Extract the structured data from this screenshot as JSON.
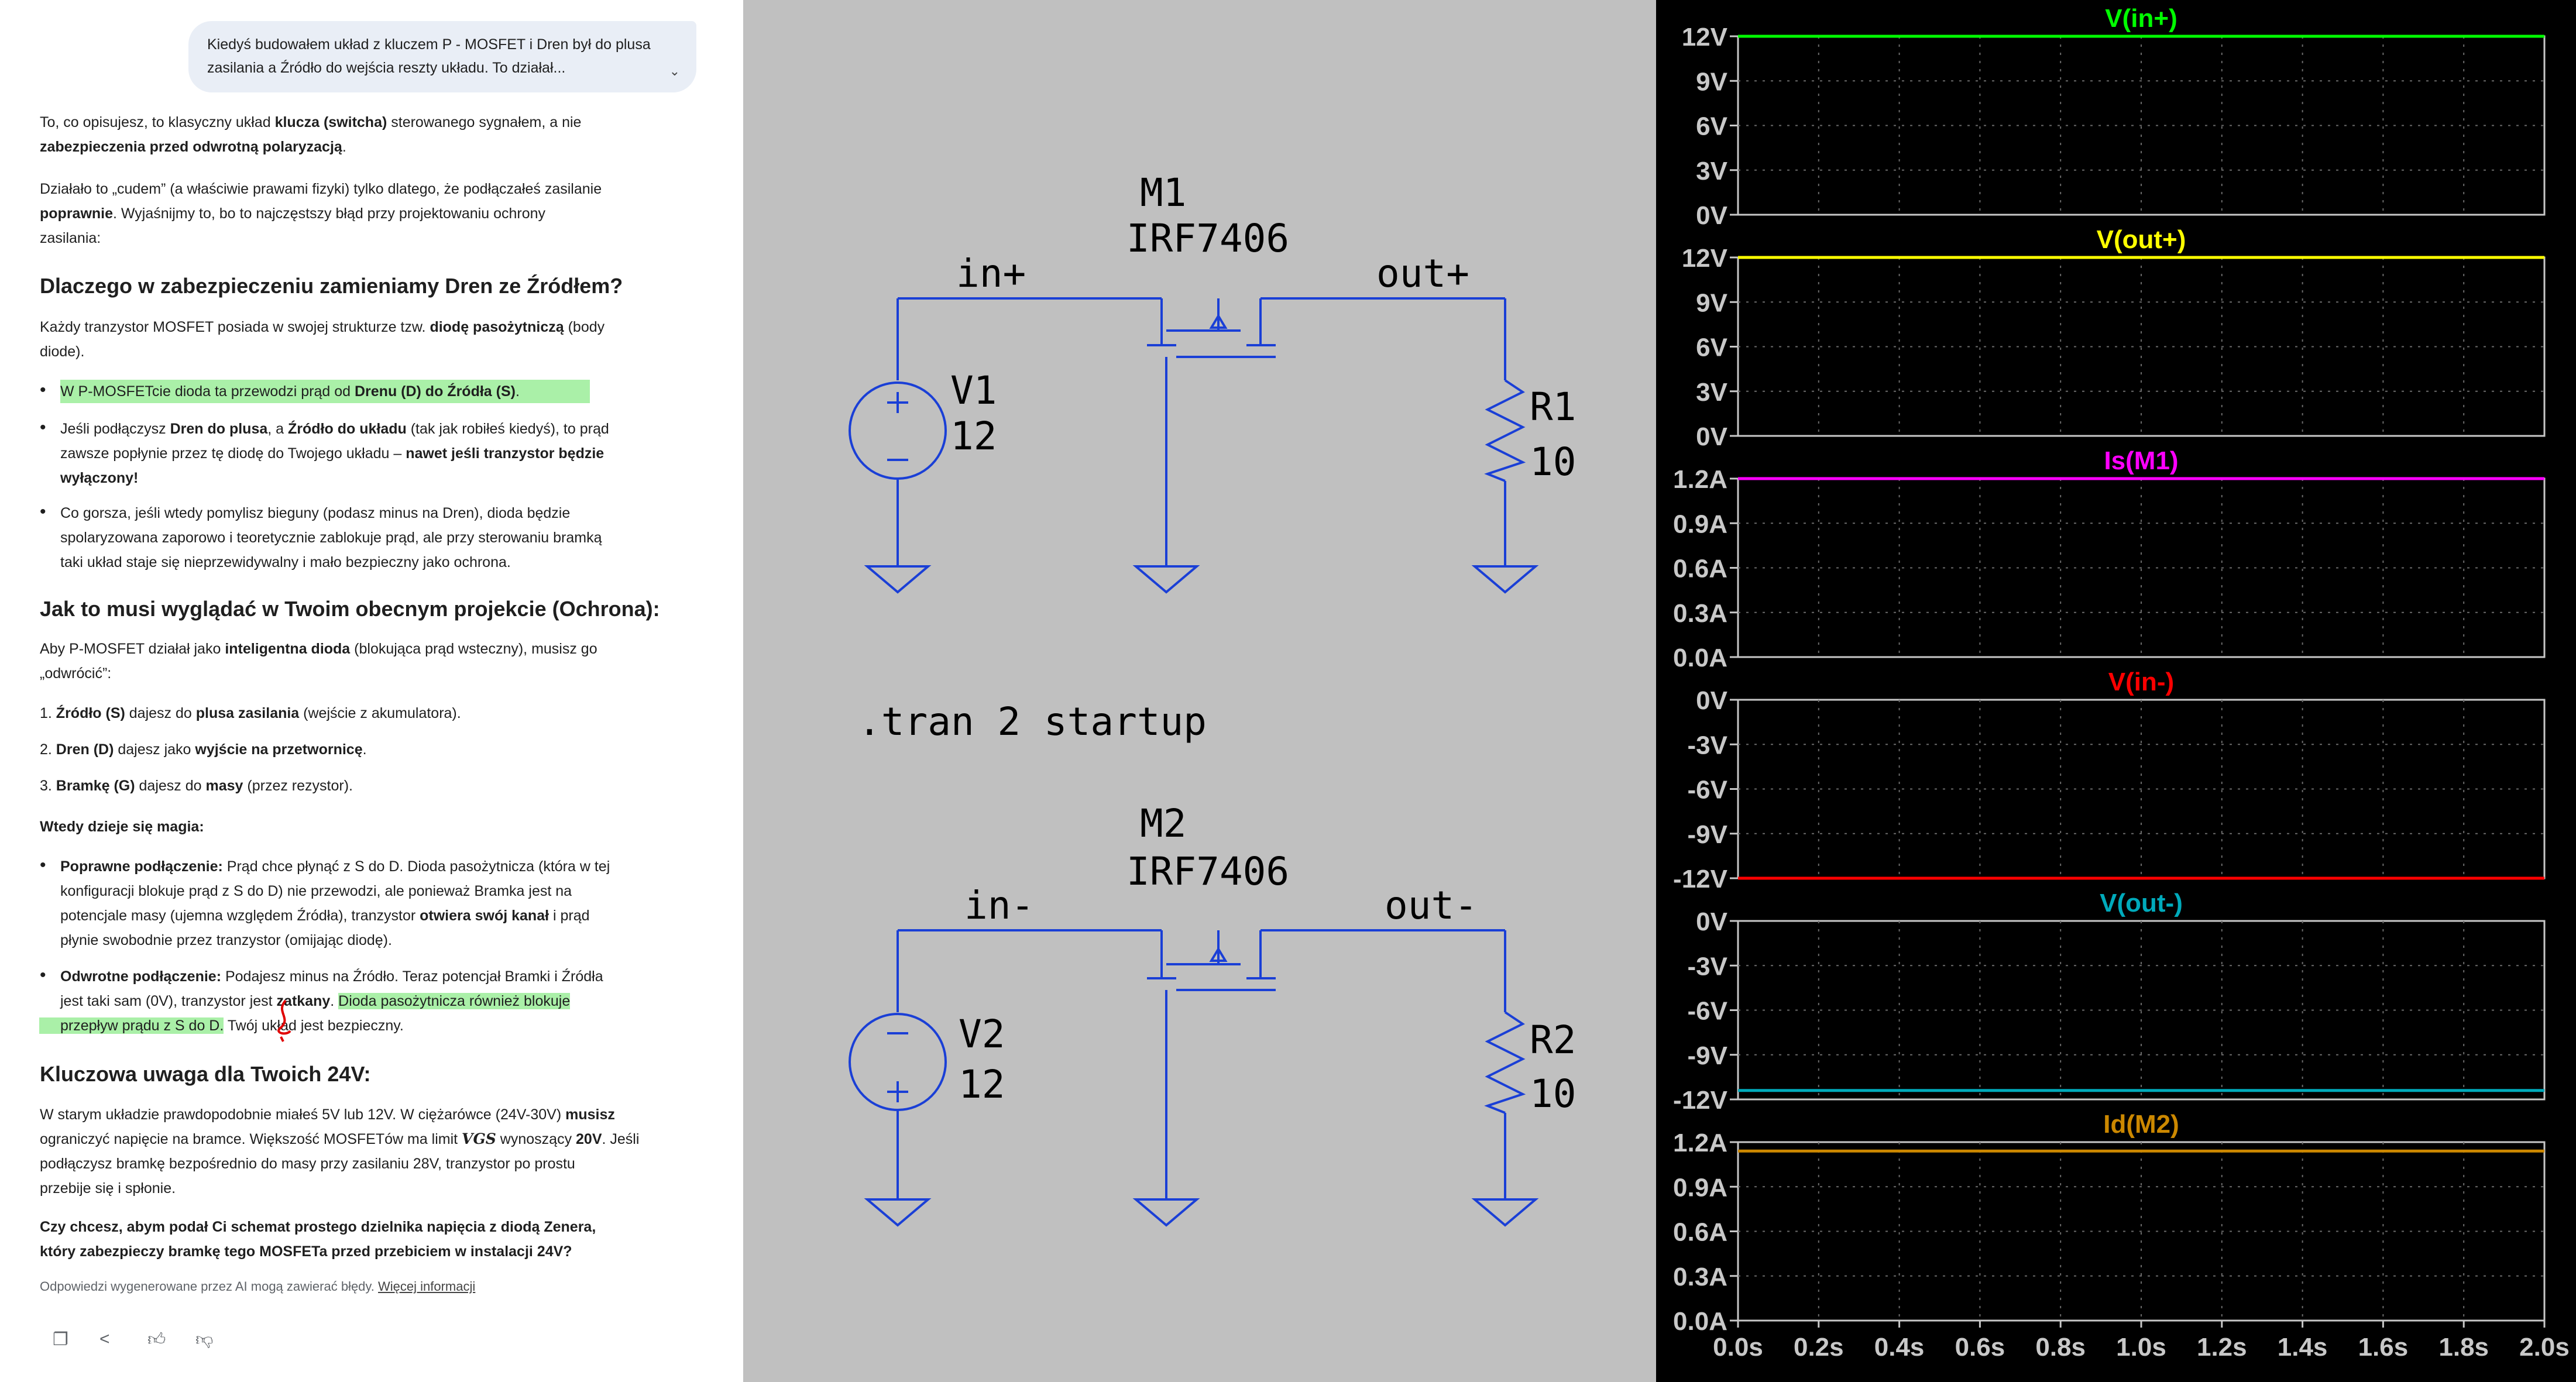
{
  "chat": {
    "user_message": "Kiedyś budowałem układ z kluczem P - MOSFET i Dren był do plusa zasilania a Źródło do wejścia reszty układu. To działał...",
    "p1a": "To, co opisujesz, to klasyczny układ ",
    "p1b": "klucza (switcha)",
    "p1c": " sterowanego sygnałem, a nie",
    "p1d": "zabezpieczenia przed odwrotną polaryzacją",
    "p1e": ".",
    "p2a": "Działało to „cudem” (a właściwie prawami fizyki) tylko dlatego, że podłączałeś zasilanie",
    "p2b": "poprawnie",
    "p2c": ". Wyjaśnijmy to, bo to najczęstszy błąd przy projektowaniu ochrony",
    "p2d": "zasilania:",
    "h1": "Dlaczego w zabezpieczeniu zamieniamy Dren ze Źródłem?",
    "p3a": "Każdy tranzystor MOSFET posiada w swojej strukturze tzw. ",
    "p3b": "diodę pasożytniczą",
    "p3c": " (body",
    "p3d": "diode).",
    "b1a": "W P-MOSFETcie dioda ta przewodzi prąd od ",
    "b1b": "Drenu (D) do Źródła (S)",
    "b1c": ".",
    "b2a": "Jeśli podłączysz ",
    "b2b": "Dren do plusa",
    "b2c": ", a ",
    "b2d": "Źródło do układu",
    "b2e": " (tak jak robiłeś kiedyś), to prąd",
    "b2f": "zawsze popłynie przez tę diodę do Twojego układu – ",
    "b2g": "nawet jeśli tranzystor będzie",
    "b2h": "wyłączony!",
    "b3a": "Co gorsza, jeśli wtedy pomylisz bieguny (podasz minus na Dren), dioda będzie",
    "b3b": "spolaryzowana zaporowo i teoretycznie zablokuje prąd, ale przy sterowaniu bramką",
    "b3c": "taki układ staje się nieprzewidywalny i mało bezpieczny jako ochrona.",
    "h2": "Jak to musi wyglądać w Twoim obecnym projekcie (Ochrona):",
    "p4a": "Aby P-MOSFET działał jako ",
    "p4b": "inteligentna dioda",
    "p4c": " (blokująca prąd wsteczny), musisz go",
    "p4d": "„odwrócić”:",
    "n1a": "1. ",
    "n1b": "Źródło (S)",
    "n1c": " dajesz do ",
    "n1d": "plusa zasilania",
    "n1e": " (wejście z akumulatora).",
    "n2a": "2. ",
    "n2b": "Dren (D)",
    "n2c": " dajesz jako ",
    "n2d": "wyjście na przetwornicę",
    "n2e": ".",
    "n3a": "3. ",
    "n3b": "Bramkę (G)",
    "n3c": " dajesz do ",
    "n3d": "masy",
    "n3e": " (przez rezystor).",
    "p5": "Wtedy dzieje się magia:",
    "c1a": "Poprawne podłączenie:",
    "c1b": " Prąd chce płynąć z S do D. Dioda pasożytnicza (która w tej",
    "c1c": "konfiguracji blokuje prąd z S do D) nie przewodzi, ale ponieważ Bramka jest na",
    "c1d": "potencjale masy (ujemna względem Źródła), tranzystor ",
    "c1e": "otwiera swój kanał",
    "c1f": " i prąd",
    "c1g": "płynie swobodnie przez tranzystor (omijając diodę).",
    "c2a": "Odwrotne podłączenie:",
    "c2b": " Podajesz minus na Źródło. Teraz potencjał Bramki i Źródła",
    "c2c": "jest taki sam (0V), tranzystor jest ",
    "c2d": "zatkany",
    "c2e": ". ",
    "c2f": "Dioda pasożytnicza również blokuje",
    "c2g": "przepływ prądu z S do D.",
    "c2h": " Twój układ jest bezpieczny.",
    "h3": "Kluczowa uwaga dla Twoich 24V:",
    "p6a": "W starym układzie prawdopodobnie miałeś 5V lub 12V. W ciężarówce (24V-30V) ",
    "p6b": "musisz",
    "p6c": "ograniczyć napięcie na bramce. Większość MOSFETów ma limit ",
    "p6d": "VGS",
    "p6e": " wynoszący ",
    "p6f": "20V",
    "p6g": ". Jeśli",
    "p6h": "podłączysz bramkę bezpośrednio do masy przy zasilaniu 28V, tranzystor po prostu",
    "p6i": "przebije się i spłonie.",
    "q1": "Czy chcesz, abym podał Ci schemat prostego dzielnika napięcia z diodą Zenera,",
    "q2": "który zabezpieczy bramkę tego MOSFETa przed przebiciem w instalacji 24V?",
    "footer_text": "Odpowiedzi wygenerowane przez AI mogą zawierać błędy. ",
    "footer_link": "Więcej informacji"
  },
  "schematic": {
    "m1_name": "M1",
    "m1_model": "IRF7406",
    "m2_name": "M2",
    "m2_model": "IRF7406",
    "net_in_plus": "in+",
    "net_out_plus": "out+",
    "net_in_minus": "in-",
    "net_out_minus": "out-",
    "v1_name": "V1",
    "v1_value": "12",
    "v2_name": "V2",
    "v2_value": "12",
    "r1_name": "R1",
    "r1_value": "10",
    "r2_name": "R2",
    "r2_value": "10",
    "directive": ".tran 2 startup"
  },
  "plots": {
    "x_ticks": [
      "0.0s",
      "0.2s",
      "0.4s",
      "0.6s",
      "0.8s",
      "1.0s",
      "1.2s",
      "1.4s",
      "1.6s",
      "1.8s",
      "2.0s"
    ],
    "panes": [
      {
        "title": "V(in+)",
        "color": "#00ff00",
        "ticks": [
          "12V",
          "9V",
          "6V",
          "3V",
          "0V"
        ]
      },
      {
        "title": "V(out+)",
        "color": "#ffff00",
        "ticks": [
          "12V",
          "9V",
          "6V",
          "3V",
          "0V"
        ]
      },
      {
        "title": "Is(M1)",
        "color": "#ff00ff",
        "ticks": [
          "1.2A",
          "0.9A",
          "0.6A",
          "0.3A",
          "0.0A"
        ]
      },
      {
        "title": "V(in-)",
        "color": "#ff0000",
        "ticks": [
          "0V",
          "-3V",
          "-6V",
          "-9V",
          "-12V"
        ]
      },
      {
        "title": "V(out-)",
        "color": "#00aabb",
        "ticks": [
          "0V",
          "-3V",
          "-6V",
          "-9V",
          "-12V"
        ]
      },
      {
        "title": "Id(M2)",
        "color": "#cc8800",
        "ticks": [
          "1.2A",
          "0.9A",
          "0.6A",
          "0.3A",
          "0.0A"
        ]
      }
    ]
  },
  "chart_data": {
    "type": "line",
    "x": [
      0.0,
      2.0
    ],
    "xlim": [
      0,
      2.0
    ],
    "grid": true,
    "series": [
      {
        "name": "V(in+)",
        "values": [
          12,
          12
        ],
        "ylim": [
          0,
          12
        ]
      },
      {
        "name": "V(out+)",
        "values": [
          12,
          12
        ],
        "ylim": [
          0,
          12
        ]
      },
      {
        "name": "Is(M1)",
        "values": [
          1.2,
          1.2
        ],
        "ylim": [
          0,
          1.2
        ]
      },
      {
        "name": "V(in-)",
        "values": [
          -12,
          -12
        ],
        "ylim": [
          -12,
          0
        ]
      },
      {
        "name": "V(out-)",
        "values": [
          -11.4,
          -11.4
        ],
        "ylim": [
          -12,
          0
        ]
      },
      {
        "name": "Id(M2)",
        "values": [
          1.14,
          1.14
        ],
        "ylim": [
          0,
          1.2
        ]
      }
    ]
  }
}
